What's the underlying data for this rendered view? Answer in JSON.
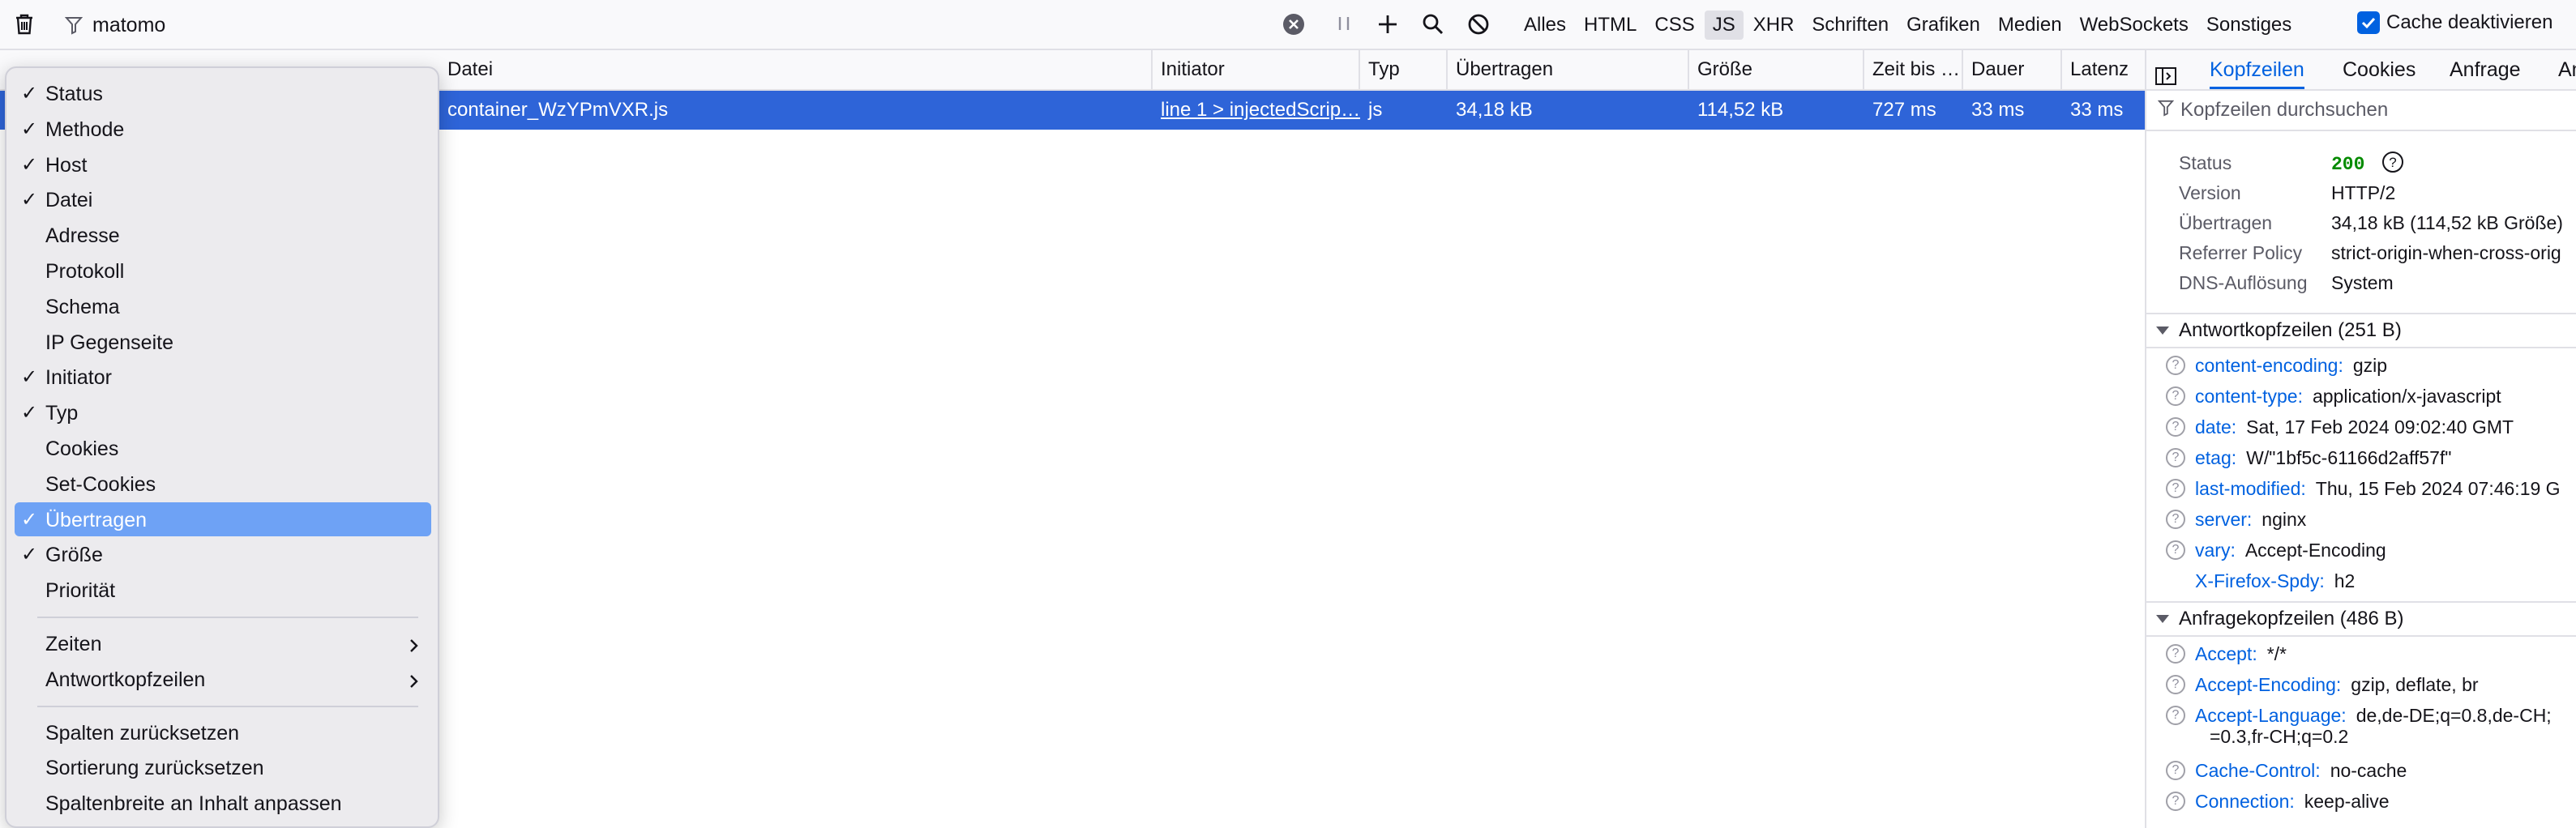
{
  "toolbar": {
    "filter_value": "matomo",
    "type_filters": [
      "Alles",
      "HTML",
      "CSS",
      "JS",
      "XHR",
      "Schriften",
      "Grafiken",
      "Medien",
      "WebSockets",
      "Sonstiges"
    ],
    "active_type_filter": "JS",
    "cache_label": "Cache deaktivieren",
    "cache_checked": true
  },
  "table": {
    "headers": {
      "datei": "Datei",
      "initiator": "Initiator",
      "typ": "Typ",
      "uebertragen": "Übertragen",
      "groesse": "Größe",
      "zeit_bis": "Zeit bis …",
      "dauer": "Dauer",
      "latenz": "Latenz"
    },
    "row": {
      "datei": "container_WzYPmVXR.js",
      "initiator": "line 1 > injectedScrip…",
      "typ": "js",
      "uebertragen": "34,18 kB",
      "groesse": "114,52 kB",
      "zeit_bis": "727 ms",
      "dauer": "33 ms",
      "latenz": "33 ms"
    }
  },
  "panel": {
    "tabs": [
      "Kopfzeilen",
      "Cookies",
      "Anfrage",
      "An"
    ],
    "active_tab": "Kopfzeilen",
    "search_placeholder": "Kopfzeilen durchsuchen",
    "summary": {
      "status_label": "Status",
      "status_value": "200",
      "version_label": "Version",
      "version_value": "HTTP/2",
      "transfer_label": "Übertragen",
      "transfer_value": "34,18 kB (114,52 kB Größe)",
      "referrer_label": "Referrer Policy",
      "referrer_value": "strict-origin-when-cross-orig",
      "dns_label": "DNS-Auflösung",
      "dns_value": "System"
    },
    "response_headers_title": "Antwortkopfzeilen (251 B)",
    "response_headers": [
      {
        "name": "content-encoding:",
        "value": "gzip",
        "help": true
      },
      {
        "name": "content-type:",
        "value": "application/x-javascript",
        "help": true
      },
      {
        "name": "date:",
        "value": "Sat, 17 Feb 2024 09:02:40 GMT",
        "help": true
      },
      {
        "name": "etag:",
        "value": "W/\"1bf5c-61166d2aff57f\"",
        "help": true
      },
      {
        "name": "last-modified:",
        "value": "Thu, 15 Feb 2024 07:46:19 G",
        "help": true
      },
      {
        "name": "server:",
        "value": "nginx",
        "help": true
      },
      {
        "name": "vary:",
        "value": "Accept-Encoding",
        "help": true
      },
      {
        "name": "X-Firefox-Spdy:",
        "value": "h2",
        "help": false
      }
    ],
    "request_headers_title": "Anfragekopfzeilen (486 B)",
    "request_headers": [
      {
        "name": "Accept:",
        "value": "*/*"
      },
      {
        "name": "Accept-Encoding:",
        "value": "gzip, deflate, br"
      },
      {
        "name": "Accept-Language:",
        "value": "de,de-DE;q=0.8,de-CH;"
      },
      {
        "name": "Cache-Control:",
        "value": "no-cache"
      },
      {
        "name": "Connection:",
        "value": "keep-alive"
      }
    ],
    "accept_language_cont": "=0.3,fr-CH;q=0.2"
  },
  "context_menu": {
    "columns": [
      {
        "label": "Status",
        "checked": true
      },
      {
        "label": "Methode",
        "checked": true
      },
      {
        "label": "Host",
        "checked": true
      },
      {
        "label": "Datei",
        "checked": true
      },
      {
        "label": "Adresse",
        "checked": false
      },
      {
        "label": "Protokoll",
        "checked": false
      },
      {
        "label": "Schema",
        "checked": false
      },
      {
        "label": "IP Gegenseite",
        "checked": false
      },
      {
        "label": "Initiator",
        "checked": true
      },
      {
        "label": "Typ",
        "checked": true
      },
      {
        "label": "Cookies",
        "checked": false
      },
      {
        "label": "Set-Cookies",
        "checked": false
      },
      {
        "label": "Übertragen",
        "checked": true,
        "selected": true
      },
      {
        "label": "Größe",
        "checked": true
      },
      {
        "label": "Priorität",
        "checked": false
      }
    ],
    "submenus": [
      "Zeiten",
      "Antwortkopfzeilen"
    ],
    "actions": [
      "Spalten zurücksetzen",
      "Sortierung zurücksetzen",
      "Spaltenbreite an Inhalt anpassen"
    ],
    "check_glyph": "✓",
    "arrow_glyph": "›"
  }
}
